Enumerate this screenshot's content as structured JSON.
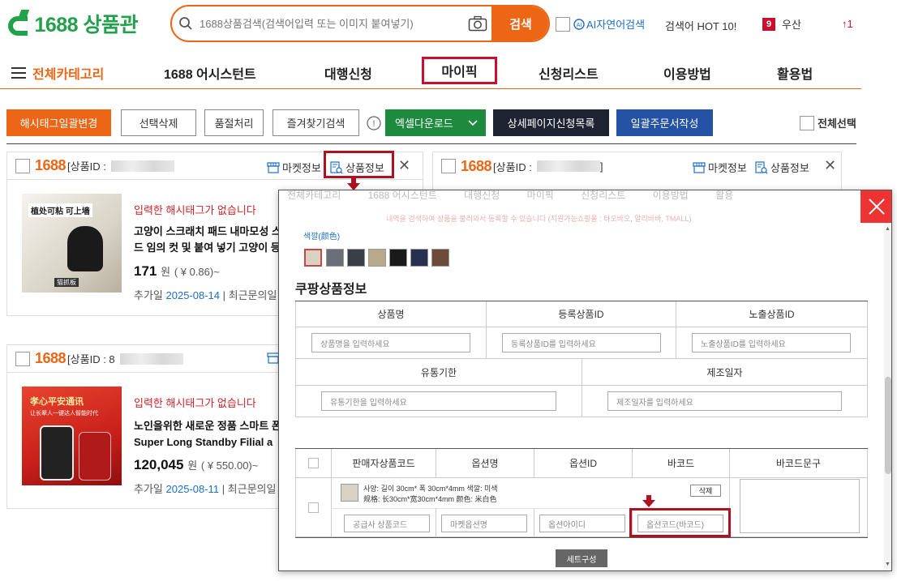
{
  "header": {
    "logo_text": "1688 상품관",
    "search_placeholder": "1688상품검색(검색어입력 또는 이미지 붙여넣기)",
    "search_button": "검색",
    "ai_search_label": "AI자연어검색",
    "hot_keywords": "검색어 HOT 10!",
    "weather_rank": "9",
    "weather_text": "우산",
    "rank_change": "↑1"
  },
  "nav": {
    "all_categories": "전체카테고리",
    "items": [
      "1688 어시스턴트",
      "대행신청",
      "마이픽",
      "신청리스트",
      "이용방법",
      "활용법"
    ]
  },
  "toolbar": {
    "hashtag_bulk": "해시태그일괄변경",
    "delete_selected": "선택삭제",
    "soldout": "품절처리",
    "favorite_search": "즐겨찾기검색",
    "excel_download": "엑셀다운로드",
    "detail_list": "상세페이지신청목록",
    "bulk_order": "일괄주문서작성",
    "select_all": "전체선택"
  },
  "cards": [
    {
      "logo": "1688",
      "id_label": "[상품ID :",
      "market_info": "마켓정보",
      "product_info": "상품정보",
      "no_hashtag": "입력한 해시태그가 없습니다",
      "title_line1": "고양이 스크래치 패드 내마모성 스",
      "title_line2": "드 임의 컷 및 붙여 넣기 고양이 등",
      "price": "171",
      "price_unit": "원",
      "price_cny": "( ¥ 0.86)~",
      "added_label": "추가일",
      "added_date": "2025-08-14",
      "recent_label": "| 최근문의일"
    },
    {
      "logo": "1688",
      "id_label": "[상품ID :",
      "id_end": "]",
      "market_info": "마켓정보",
      "product_info": "상품정보"
    },
    {
      "logo": "1688",
      "id_label": "[상품ID : 8",
      "no_hashtag": "입력한 해시태그가 없습니다",
      "title_line1": "노인을위한 새로운 정품 스마트 폰",
      "title_line2": "Super Long Standby Filial a",
      "price": "120,045",
      "price_unit": "원",
      "price_cny": "( ¥ 550.00)~",
      "added_label": "추가일",
      "added_date": "2025-08-11",
      "recent_label": "| 최근문의일"
    }
  ],
  "card1_image_text": [
    "植处可粘  可上墙",
    "猫抓板"
  ],
  "card3_image_text": [
    "孝心平安通讯",
    "让长辈人一键达人智能时代"
  ],
  "modal": {
    "bg_strip_text": "전체카테고리          1688 어시스턴트          대행신청          마이픽          신청리스트          이용방법          활용",
    "bg_notice": "내역을 검색하여 상품을 불러와서 등록할 수 있습니다 (지원가능쇼핑몰 : 타오바오, 알리바바, TMALL)",
    "color_label": "색깔(颜色)",
    "section_title": "쿠팡상품정보",
    "row1_headers": [
      "상품명",
      "등록상품ID",
      "노출상품ID"
    ],
    "row1_placeholders": [
      "상품명을 입력하세요",
      "등록상품ID를 입력하세요",
      "노출상품ID를 입력하세요"
    ],
    "row2_headers": [
      "유통기한",
      "제조일자"
    ],
    "row2_placeholders": [
      "유통기한을 입력하세요",
      "제조일자를 입력하세요"
    ],
    "table_headers": [
      "판매자상품코드",
      "옵션명",
      "옵션ID",
      "바코드",
      "바코드문구"
    ],
    "option_line1": "사양: 길이 30cm* 폭 30cm*4mm  색깔: 미색",
    "option_line2": "规格: 长30cm*宽30cm*4mm  颜色: 米白色",
    "delete_btn": "삭제",
    "option_placeholders": [
      "공급사 상품코드",
      "마켓옵션명",
      "옵션아이디",
      "옵션코드(바코드)"
    ],
    "set_btn": "세트구성"
  },
  "colors": {
    "brand_orange": "#ec6615",
    "brand_green": "#22a04b",
    "annot_red": "#b01020",
    "excel_green": "#1e8a3e",
    "dark_navy": "#1d2330",
    "blue_btn": "#2452a4"
  },
  "icons": [
    "search-icon",
    "camera-icon",
    "ai-icon",
    "hamburger-icon",
    "info-icon",
    "chevron-down-icon",
    "store-icon",
    "doc-search-icon",
    "close-icon"
  ]
}
